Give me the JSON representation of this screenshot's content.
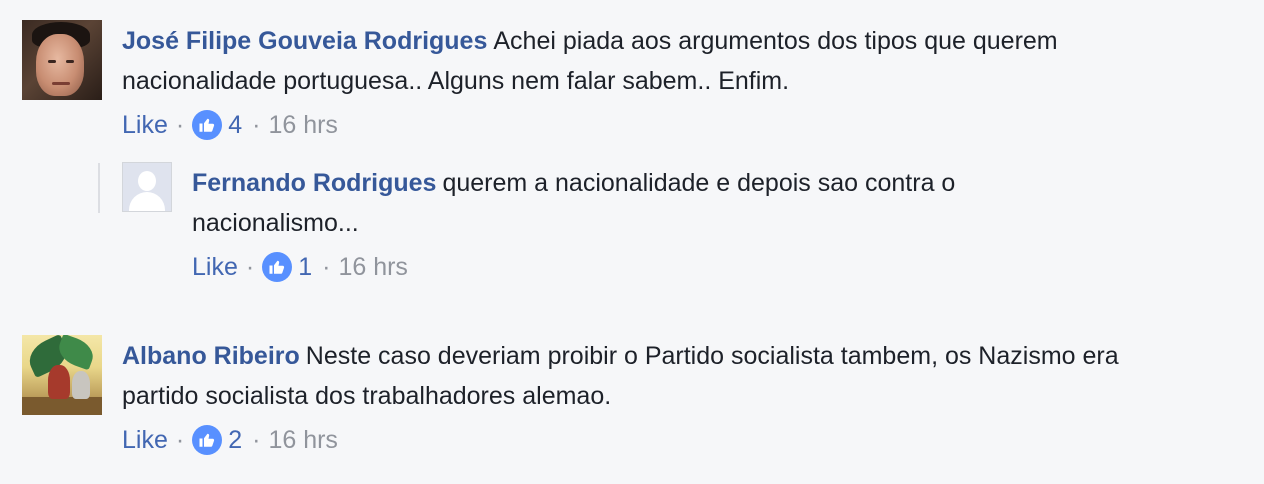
{
  "comments": [
    {
      "author": "José Filipe Gouveia Rodrigues",
      "text": "Achei piada aos argumentos dos tipos que querem nacionalidade portuguesa.. Alguns nem falar sabem.. Enfim.",
      "like_label": "Like",
      "reaction_count": "4",
      "timestamp": "16 hrs",
      "reaction_icon": "thumbs-up-icon",
      "avatar": "profile-photo-man"
    },
    {
      "author": "Fernando Rodrigues",
      "text": "querem a nacionalidade e depois sao contra o nacionalismo...",
      "like_label": "Like",
      "reaction_count": "1",
      "timestamp": "16 hrs",
      "reaction_icon": "thumbs-up-icon",
      "avatar": "default-silhouette"
    },
    {
      "author": "Albano Ribeiro",
      "text": "Neste caso deveriam proibir o Partido socialista tambem, os Nazismo era partido socialista dos trabalhadores alemao.",
      "like_label": "Like",
      "reaction_count": "2",
      "timestamp": "16 hrs",
      "reaction_icon": "thumbs-up-icon",
      "avatar": "profile-photo-painting"
    }
  ],
  "separator": "·",
  "colors": {
    "author": "#365899",
    "link": "#4267b2",
    "text": "#1d2129",
    "meta": "#90949c",
    "reaction": "#5890ff",
    "background": "#f6f7f9"
  }
}
